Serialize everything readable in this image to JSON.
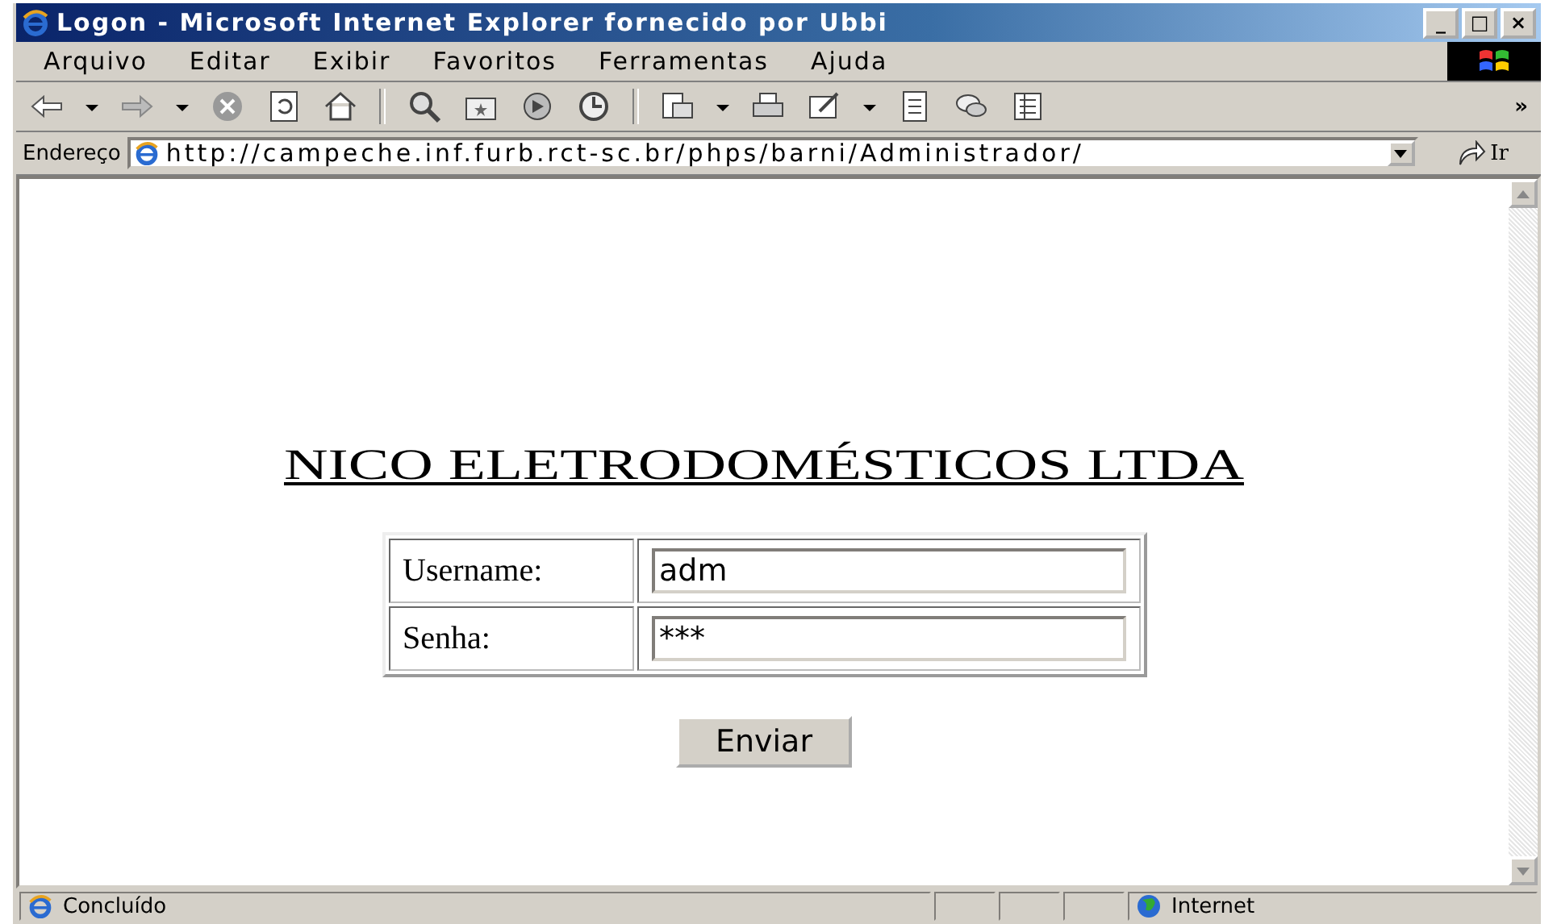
{
  "window": {
    "title": "Logon - Microsoft Internet Explorer fornecido por Ubbi",
    "controls": [
      "_",
      "□",
      "×"
    ]
  },
  "menu": [
    {
      "label": "Arquivo"
    },
    {
      "label": "Editar"
    },
    {
      "label": "Exibir"
    },
    {
      "label": "Favoritos"
    },
    {
      "label": "Ferramentas"
    },
    {
      "label": "Ajuda"
    }
  ],
  "toolbar": {
    "overflow": "»"
  },
  "address": {
    "label": "Endereço",
    "value": "http://campeche.inf.furb.rct-sc.br/phps/barni/Administrador/",
    "go": "Ir"
  },
  "page": {
    "heading": "NICO ELETRODOMÉSTICOS LTDA",
    "fields": [
      {
        "label": "Username:",
        "value": "adm"
      },
      {
        "label": "Senha:",
        "value": "***"
      }
    ],
    "submit": "Enviar"
  },
  "status_bar": {
    "text": "Concluído",
    "zone": "Internet"
  }
}
